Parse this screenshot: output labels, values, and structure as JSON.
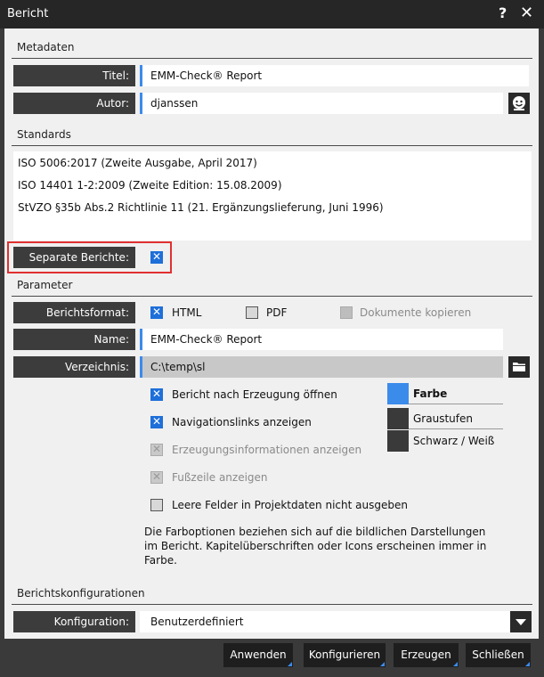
{
  "window": {
    "title": "Bericht",
    "help": "?",
    "close": "✕"
  },
  "metadata": {
    "section": "Metadaten",
    "title_label": "Titel:",
    "title_value": "EMM-Check® Report",
    "author_label": "Autor:",
    "author_value": "djanssen"
  },
  "standards": {
    "section": "Standards",
    "items": [
      "ISO 5006:2017 (Zweite Ausgabe, April 2017)",
      "ISO 14401 1-2:2009 (Zweite Edition: 15.08.2009)",
      "StVZO §35b Abs.2 Richtlinie 11 (21. Ergänzungslieferung, Juni 1996)"
    ],
    "separate_label": "Separate Berichte:",
    "separate_checked": true
  },
  "parameters": {
    "section": "Parameter",
    "format_label": "Berichtsformat:",
    "html_label": "HTML",
    "pdf_label": "PDF",
    "copy_docs_label": "Dokumente kopieren",
    "name_label": "Name:",
    "name_value": "EMM-Check® Report",
    "dir_label": "Verzeichnis:",
    "dir_value": "C:\\temp\\sl",
    "options": [
      {
        "label": "Bericht nach Erzeugung öffnen",
        "checked": true,
        "disabled": false
      },
      {
        "label": "Navigationslinks anzeigen",
        "checked": true,
        "disabled": false
      },
      {
        "label": "Erzeugungsinformationen anzeigen",
        "checked": true,
        "disabled": true
      },
      {
        "label": "Fußzeile anzeigen",
        "checked": true,
        "disabled": true
      },
      {
        "label": "Leere Felder in Projektdaten nicht ausgeben",
        "checked": false,
        "disabled": false
      }
    ],
    "colors": [
      {
        "label": "Farbe",
        "selected": true
      },
      {
        "label": "Graustufen",
        "selected": false
      },
      {
        "label": "Schwarz / Weiß",
        "selected": false
      }
    ],
    "note": "Die Farboptionen beziehen sich auf die bildlichen Darstellungen im Bericht. Kapitelüberschriften oder Icons erscheinen immer in Farbe."
  },
  "configs": {
    "section": "Berichtskonfigurationen",
    "label": "Konfiguration:",
    "value": "Benutzerdefiniert"
  },
  "buttons": {
    "apply": "Anwenden",
    "configure": "Konfigurieren",
    "generate": "Erzeugen",
    "close": "Schließen"
  },
  "colors": {
    "accent": "#3b8beb",
    "dark": "#3c3c3c",
    "highlight": "#e03030"
  }
}
